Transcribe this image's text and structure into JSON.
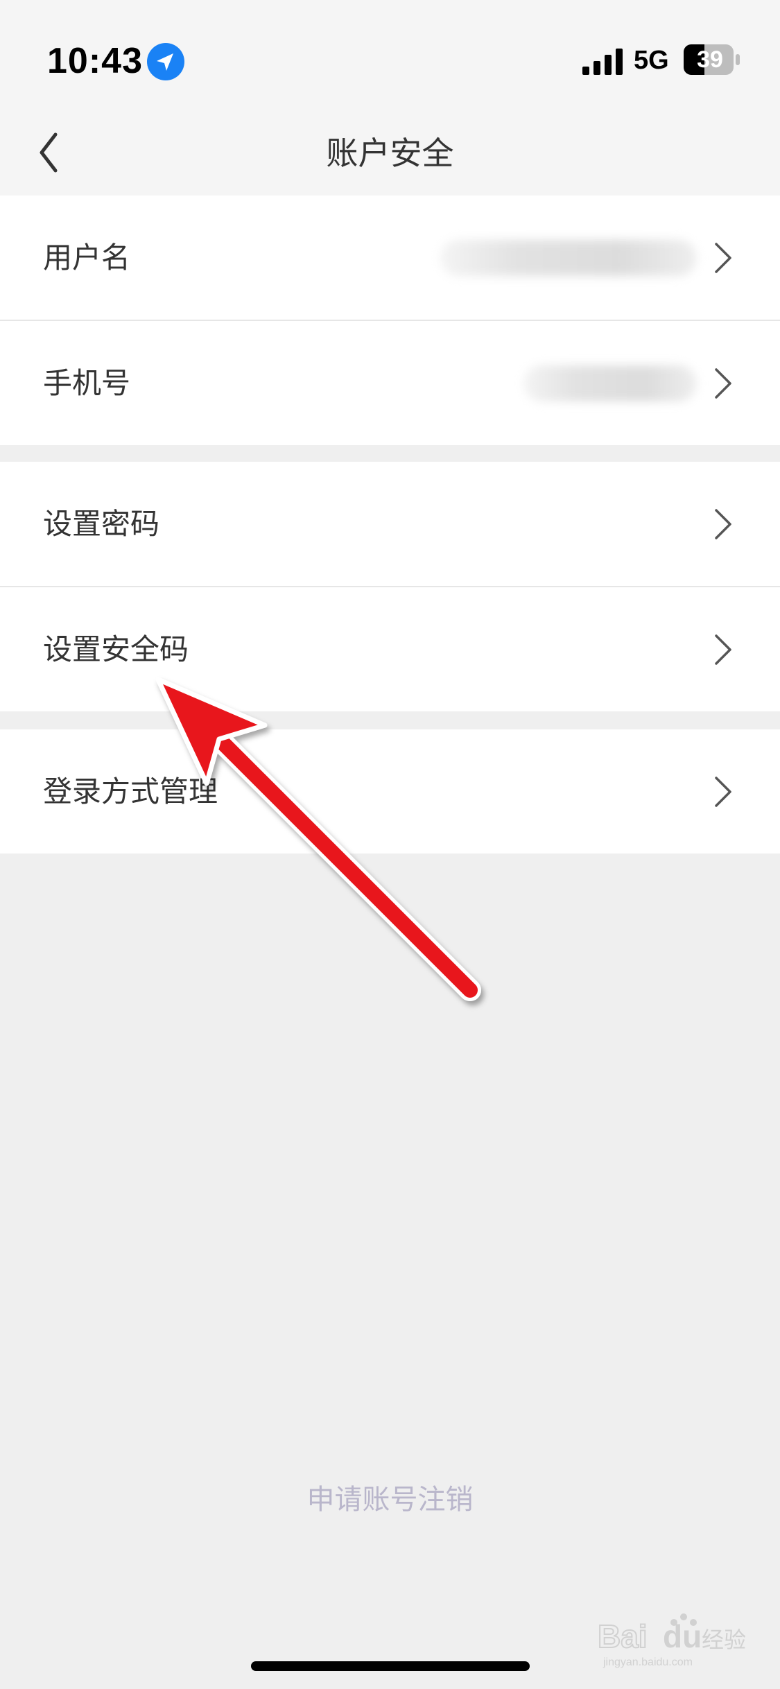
{
  "status_bar": {
    "time": "10:43",
    "network": "5G",
    "battery_level": "39",
    "icons": [
      "location-arrow-icon",
      "signal-icon",
      "battery-icon"
    ]
  },
  "nav": {
    "title": "账户安全",
    "back_icon": "chevron-left-icon"
  },
  "groups": [
    {
      "items": [
        {
          "label": "用户名",
          "value_blurred": true
        },
        {
          "label": "手机号",
          "value_blurred": true
        }
      ]
    },
    {
      "items": [
        {
          "label": "设置密码"
        },
        {
          "label": "设置安全码"
        }
      ]
    },
    {
      "items": [
        {
          "label": "登录方式管理"
        }
      ]
    }
  ],
  "footer": {
    "deregister_label": "申请账号注销"
  },
  "watermark": {
    "text": "Baidu经验",
    "subtext": "jingyan.baidu.com"
  },
  "colors": {
    "accent_blue": "#1a82f5",
    "annotation_red": "#e8141c",
    "deregister_text": "#b9b6cb",
    "page_background": "#efefef",
    "nav_background": "#f5f5f5"
  }
}
